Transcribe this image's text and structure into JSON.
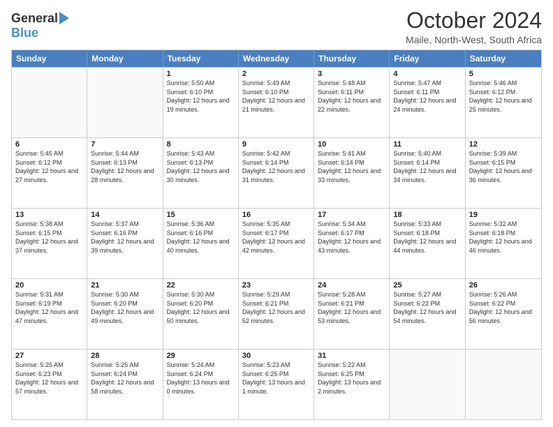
{
  "logo": {
    "general": "General",
    "blue": "Blue"
  },
  "header": {
    "month_year": "October 2024",
    "location": "Maile, North-West, South Africa"
  },
  "weekdays": [
    "Sunday",
    "Monday",
    "Tuesday",
    "Wednesday",
    "Thursday",
    "Friday",
    "Saturday"
  ],
  "weeks": [
    [
      {
        "day": "",
        "empty": true,
        "sunrise": "",
        "sunset": "",
        "daylight": ""
      },
      {
        "day": "",
        "empty": true,
        "sunrise": "",
        "sunset": "",
        "daylight": ""
      },
      {
        "day": "1",
        "empty": false,
        "sunrise": "Sunrise: 5:50 AM",
        "sunset": "Sunset: 6:10 PM",
        "daylight": "Daylight: 12 hours and 19 minutes."
      },
      {
        "day": "2",
        "empty": false,
        "sunrise": "Sunrise: 5:49 AM",
        "sunset": "Sunset: 6:10 PM",
        "daylight": "Daylight: 12 hours and 21 minutes."
      },
      {
        "day": "3",
        "empty": false,
        "sunrise": "Sunrise: 5:48 AM",
        "sunset": "Sunset: 6:11 PM",
        "daylight": "Daylight: 12 hours and 22 minutes."
      },
      {
        "day": "4",
        "empty": false,
        "sunrise": "Sunrise: 5:47 AM",
        "sunset": "Sunset: 6:11 PM",
        "daylight": "Daylight: 12 hours and 24 minutes."
      },
      {
        "day": "5",
        "empty": false,
        "sunrise": "Sunrise: 5:46 AM",
        "sunset": "Sunset: 6:12 PM",
        "daylight": "Daylight: 12 hours and 25 minutes."
      }
    ],
    [
      {
        "day": "6",
        "empty": false,
        "sunrise": "Sunrise: 5:45 AM",
        "sunset": "Sunset: 6:12 PM",
        "daylight": "Daylight: 12 hours and 27 minutes."
      },
      {
        "day": "7",
        "empty": false,
        "sunrise": "Sunrise: 5:44 AM",
        "sunset": "Sunset: 6:13 PM",
        "daylight": "Daylight: 12 hours and 28 minutes."
      },
      {
        "day": "8",
        "empty": false,
        "sunrise": "Sunrise: 5:43 AM",
        "sunset": "Sunset: 6:13 PM",
        "daylight": "Daylight: 12 hours and 30 minutes."
      },
      {
        "day": "9",
        "empty": false,
        "sunrise": "Sunrise: 5:42 AM",
        "sunset": "Sunset: 6:14 PM",
        "daylight": "Daylight: 12 hours and 31 minutes."
      },
      {
        "day": "10",
        "empty": false,
        "sunrise": "Sunrise: 5:41 AM",
        "sunset": "Sunset: 6:14 PM",
        "daylight": "Daylight: 12 hours and 33 minutes."
      },
      {
        "day": "11",
        "empty": false,
        "sunrise": "Sunrise: 5:40 AM",
        "sunset": "Sunset: 6:14 PM",
        "daylight": "Daylight: 12 hours and 34 minutes."
      },
      {
        "day": "12",
        "empty": false,
        "sunrise": "Sunrise: 5:39 AM",
        "sunset": "Sunset: 6:15 PM",
        "daylight": "Daylight: 12 hours and 36 minutes."
      }
    ],
    [
      {
        "day": "13",
        "empty": false,
        "sunrise": "Sunrise: 5:38 AM",
        "sunset": "Sunset: 6:15 PM",
        "daylight": "Daylight: 12 hours and 37 minutes."
      },
      {
        "day": "14",
        "empty": false,
        "sunrise": "Sunrise: 5:37 AM",
        "sunset": "Sunset: 6:16 PM",
        "daylight": "Daylight: 12 hours and 39 minutes."
      },
      {
        "day": "15",
        "empty": false,
        "sunrise": "Sunrise: 5:36 AM",
        "sunset": "Sunset: 6:16 PM",
        "daylight": "Daylight: 12 hours and 40 minutes."
      },
      {
        "day": "16",
        "empty": false,
        "sunrise": "Sunrise: 5:35 AM",
        "sunset": "Sunset: 6:17 PM",
        "daylight": "Daylight: 12 hours and 42 minutes."
      },
      {
        "day": "17",
        "empty": false,
        "sunrise": "Sunrise: 5:34 AM",
        "sunset": "Sunset: 6:17 PM",
        "daylight": "Daylight: 12 hours and 43 minutes."
      },
      {
        "day": "18",
        "empty": false,
        "sunrise": "Sunrise: 5:33 AM",
        "sunset": "Sunset: 6:18 PM",
        "daylight": "Daylight: 12 hours and 44 minutes."
      },
      {
        "day": "19",
        "empty": false,
        "sunrise": "Sunrise: 5:32 AM",
        "sunset": "Sunset: 6:18 PM",
        "daylight": "Daylight: 12 hours and 46 minutes."
      }
    ],
    [
      {
        "day": "20",
        "empty": false,
        "sunrise": "Sunrise: 5:31 AM",
        "sunset": "Sunset: 6:19 PM",
        "daylight": "Daylight: 12 hours and 47 minutes."
      },
      {
        "day": "21",
        "empty": false,
        "sunrise": "Sunrise: 5:30 AM",
        "sunset": "Sunset: 6:20 PM",
        "daylight": "Daylight: 12 hours and 49 minutes."
      },
      {
        "day": "22",
        "empty": false,
        "sunrise": "Sunrise: 5:30 AM",
        "sunset": "Sunset: 6:20 PM",
        "daylight": "Daylight: 12 hours and 50 minutes."
      },
      {
        "day": "23",
        "empty": false,
        "sunrise": "Sunrise: 5:29 AM",
        "sunset": "Sunset: 6:21 PM",
        "daylight": "Daylight: 12 hours and 52 minutes."
      },
      {
        "day": "24",
        "empty": false,
        "sunrise": "Sunrise: 5:28 AM",
        "sunset": "Sunset: 6:21 PM",
        "daylight": "Daylight: 12 hours and 53 minutes."
      },
      {
        "day": "25",
        "empty": false,
        "sunrise": "Sunrise: 5:27 AM",
        "sunset": "Sunset: 6:22 PM",
        "daylight": "Daylight: 12 hours and 54 minutes."
      },
      {
        "day": "26",
        "empty": false,
        "sunrise": "Sunrise: 5:26 AM",
        "sunset": "Sunset: 6:22 PM",
        "daylight": "Daylight: 12 hours and 56 minutes."
      }
    ],
    [
      {
        "day": "27",
        "empty": false,
        "sunrise": "Sunrise: 5:25 AM",
        "sunset": "Sunset: 6:23 PM",
        "daylight": "Daylight: 12 hours and 57 minutes."
      },
      {
        "day": "28",
        "empty": false,
        "sunrise": "Sunrise: 5:25 AM",
        "sunset": "Sunset: 6:24 PM",
        "daylight": "Daylight: 12 hours and 58 minutes."
      },
      {
        "day": "29",
        "empty": false,
        "sunrise": "Sunrise: 5:24 AM",
        "sunset": "Sunset: 6:24 PM",
        "daylight": "Daylight: 13 hours and 0 minutes."
      },
      {
        "day": "30",
        "empty": false,
        "sunrise": "Sunrise: 5:23 AM",
        "sunset": "Sunset: 6:25 PM",
        "daylight": "Daylight: 13 hours and 1 minute."
      },
      {
        "day": "31",
        "empty": false,
        "sunrise": "Sunrise: 5:22 AM",
        "sunset": "Sunset: 6:25 PM",
        "daylight": "Daylight: 13 hours and 2 minutes."
      },
      {
        "day": "",
        "empty": true,
        "sunrise": "",
        "sunset": "",
        "daylight": ""
      },
      {
        "day": "",
        "empty": true,
        "sunrise": "",
        "sunset": "",
        "daylight": ""
      }
    ]
  ]
}
